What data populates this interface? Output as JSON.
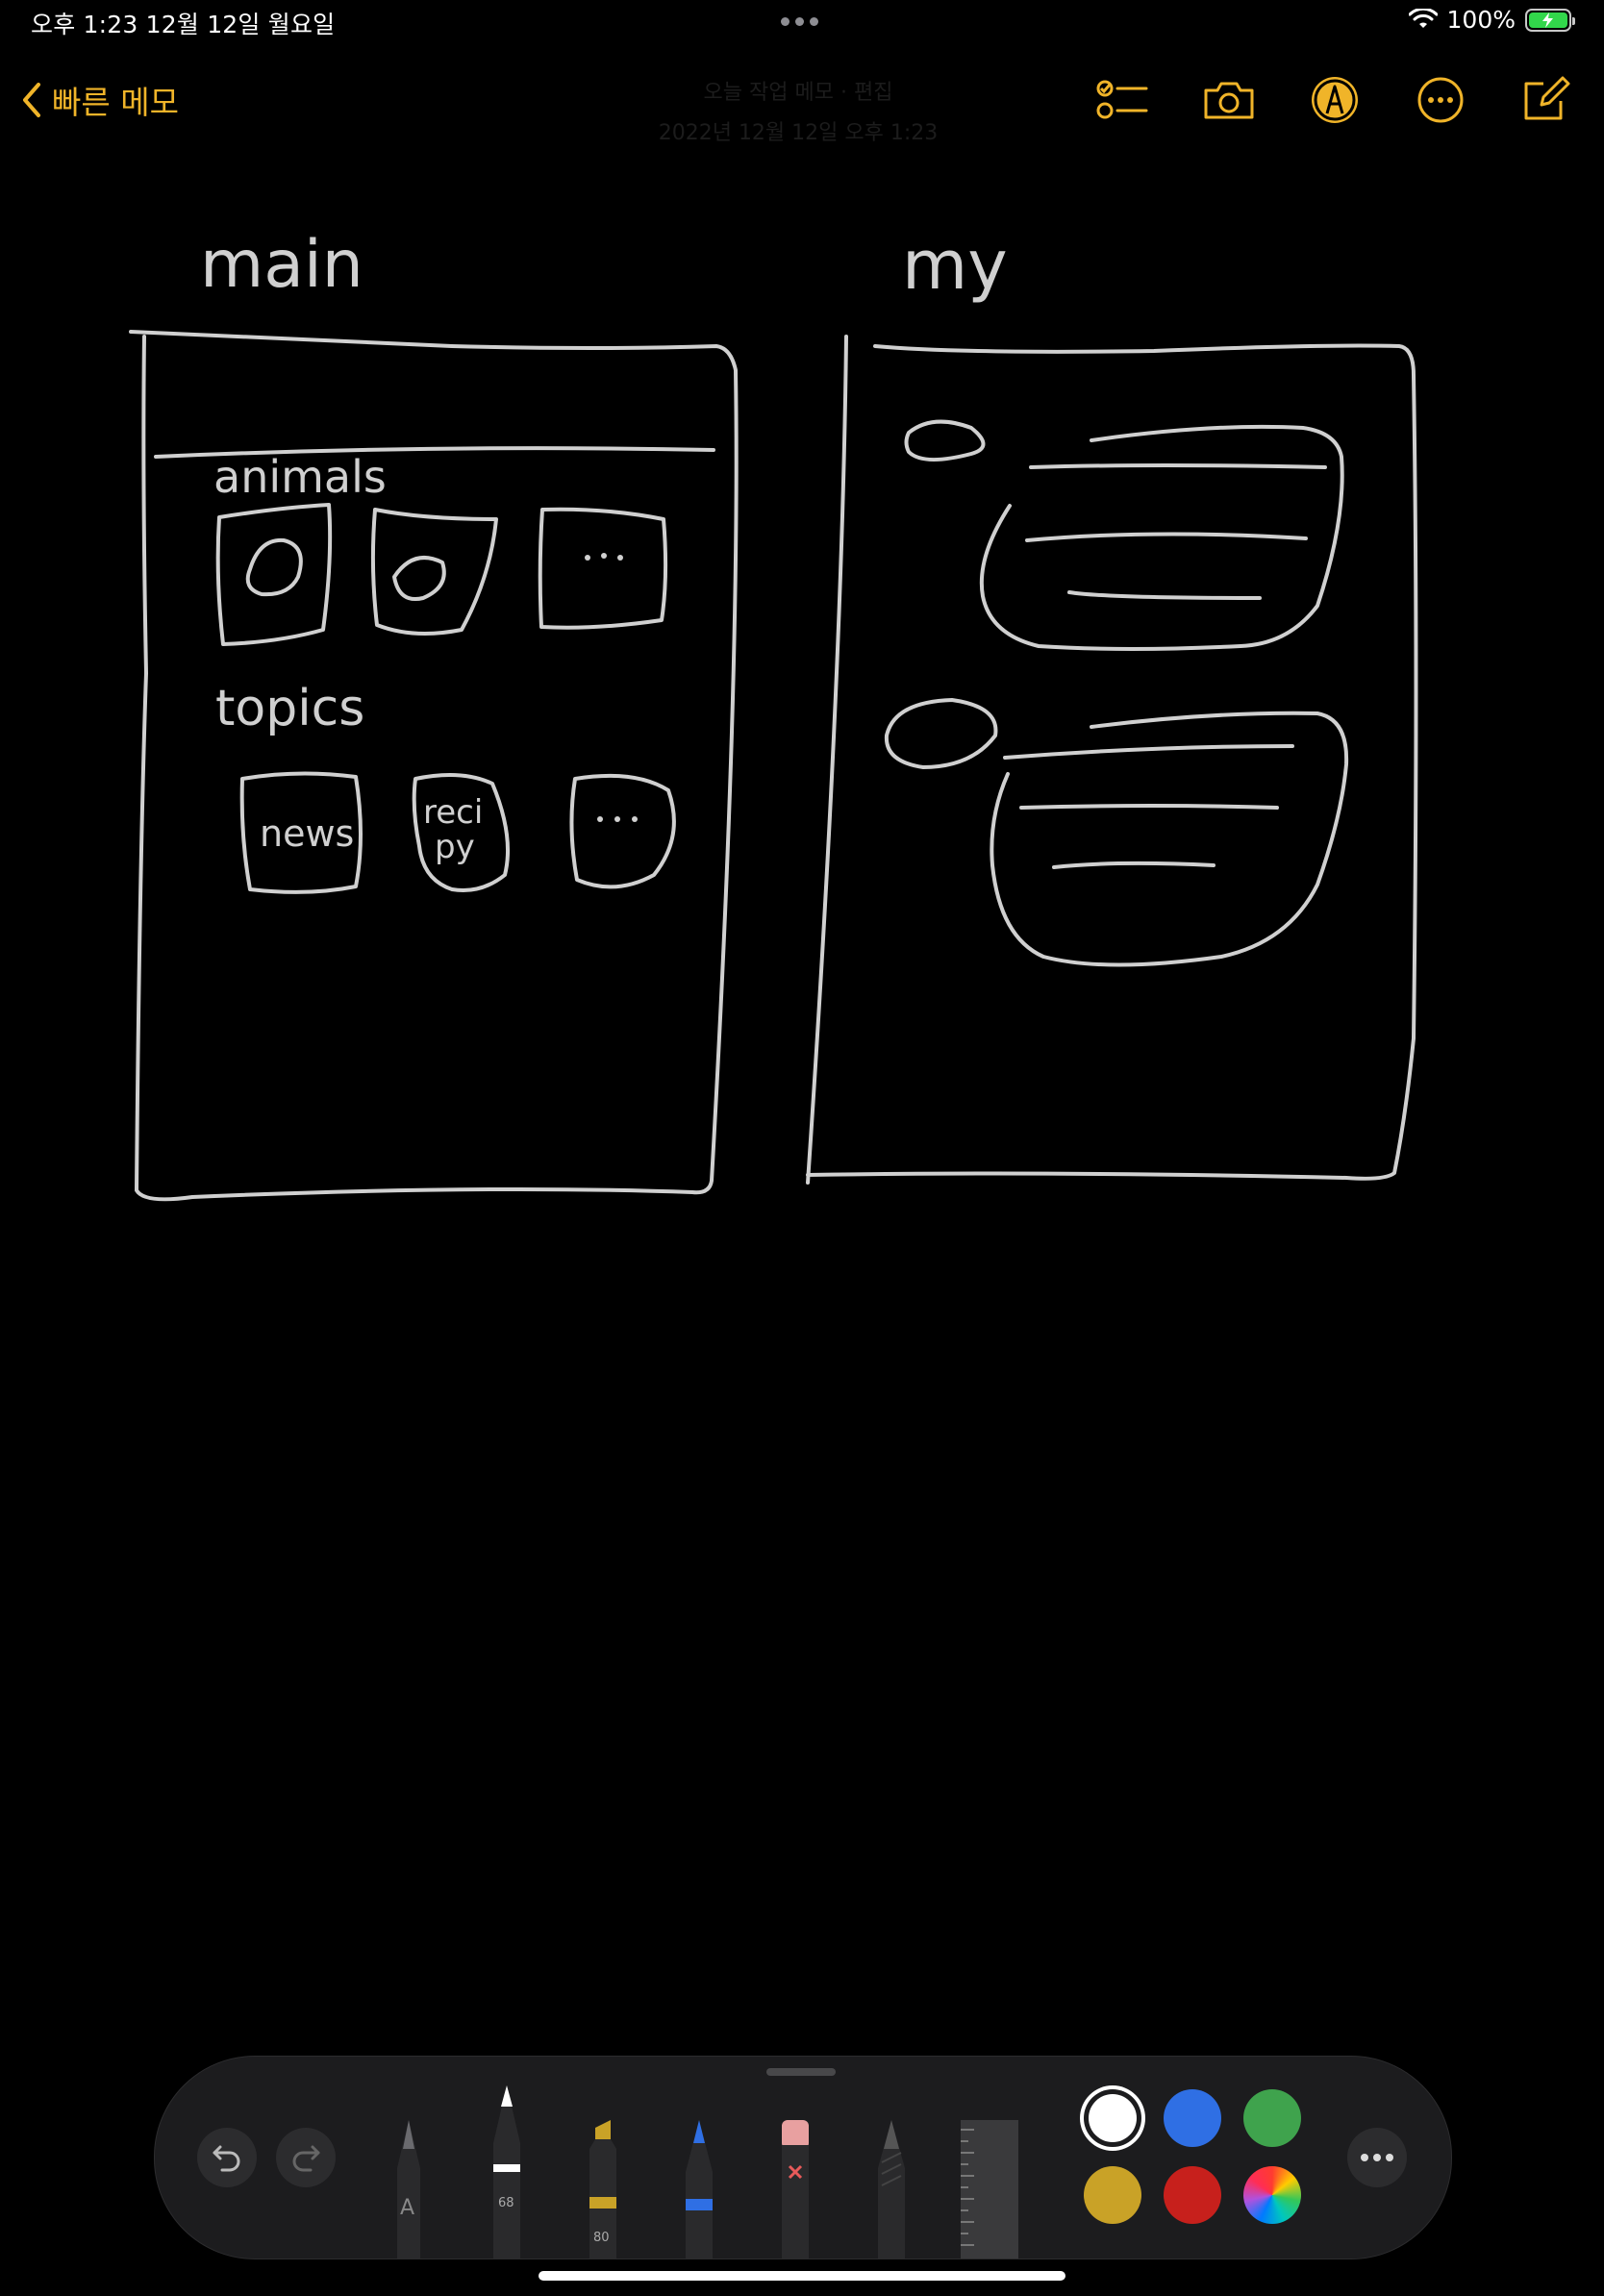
{
  "status_bar": {
    "time": "오후 1:23   12월 12일 월요일",
    "battery": "100%",
    "battery_level": 1.0
  },
  "navbar": {
    "back_label": "빠른 메모",
    "center_title": "오늘 작업 메모 · 편집",
    "center_subtitle": "2022년 12월 12일 오후 1:23",
    "icons": [
      "checklist-icon",
      "camera-icon",
      "markup-pen-icon",
      "more-icon",
      "compose-icon"
    ]
  },
  "sketch": {
    "left_label": "main",
    "section_1": "animals",
    "section_2": "topics",
    "tile_news": "news",
    "tile_recipe_line1": "reci",
    "tile_recipe_line2": "py",
    "ellipsis": "· · ·",
    "right_label": "my"
  },
  "toolbar": {
    "tools": [
      "pen",
      "marker",
      "highlighter",
      "blue-pen",
      "eraser",
      "pencil",
      "ruler"
    ],
    "pen_letter": "A",
    "marker_size": "68",
    "highlighter_size": "80",
    "colors": [
      "#ffffff",
      "#2f6fe4",
      "#3fa34d",
      "#c9a227",
      "#c7201c",
      "rainbow"
    ],
    "selected_color": "#ffffff"
  }
}
